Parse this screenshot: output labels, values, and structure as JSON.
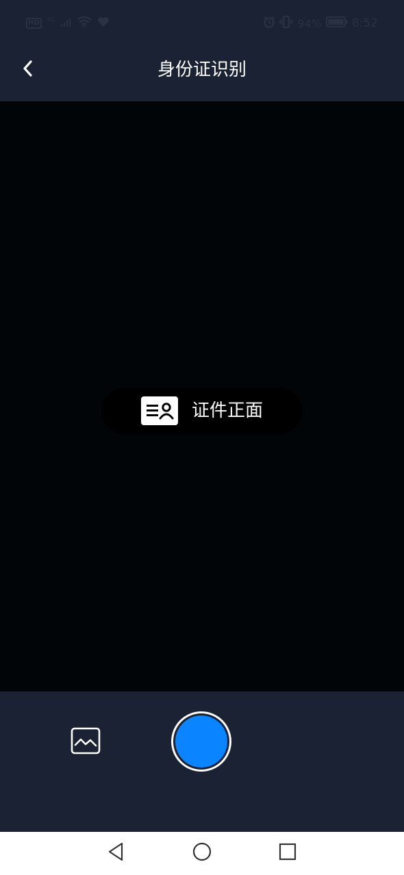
{
  "status_bar": {
    "hd_badge": "HD",
    "network_type": "4G",
    "battery_percent": "94%",
    "time": "8:52",
    "icons": [
      "hd-icon",
      "cellular-signal-icon",
      "wifi-icon",
      "heart-icon",
      "alarm-icon",
      "vibrate-icon",
      "battery-icon"
    ]
  },
  "header": {
    "title": "身份证识别",
    "back_icon": "chevron-left-icon"
  },
  "viewfinder": {
    "hint_label": "证件正面",
    "hint_icon": "id-card-icon"
  },
  "controls": {
    "gallery_icon": "gallery-icon",
    "shutter_color": "#0b84ff"
  },
  "nav_bar": {
    "icons": [
      "nav-back-icon",
      "nav-home-icon",
      "nav-recents-icon"
    ]
  },
  "colors": {
    "panel_bg": "#1a2233",
    "viewfinder_bg": "#020507",
    "accent": "#0b84ff"
  }
}
